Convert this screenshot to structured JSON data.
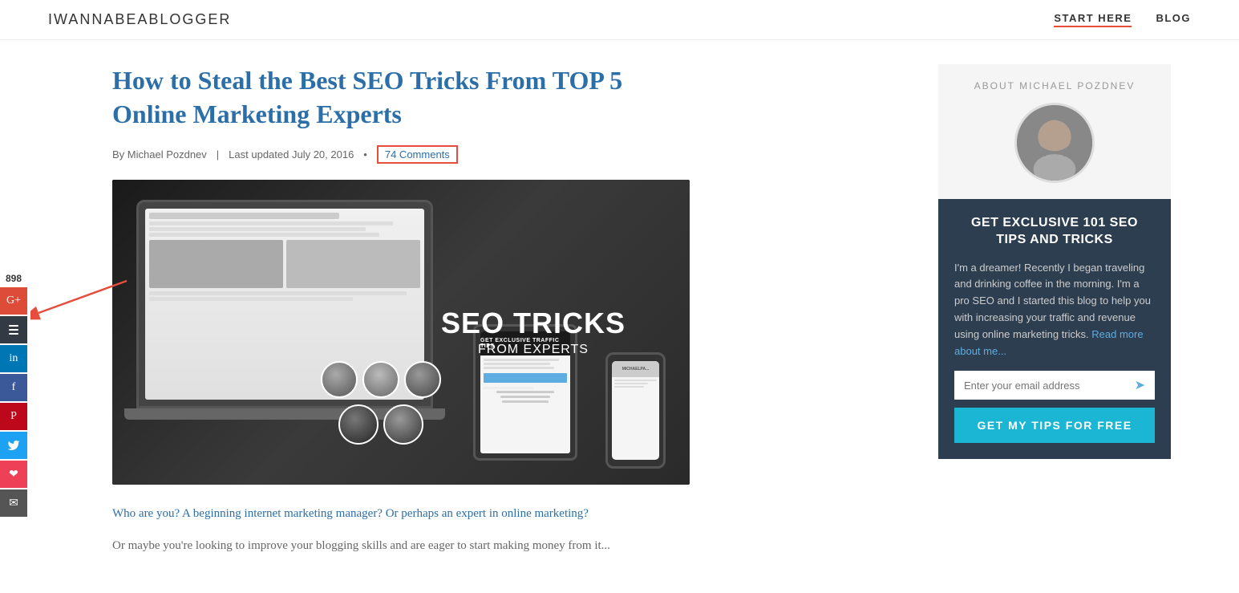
{
  "header": {
    "site_title": "IWANNABEABLOGGER",
    "nav": [
      {
        "label": "START HERE",
        "active": true
      },
      {
        "label": "BLOG",
        "active": false
      }
    ]
  },
  "article": {
    "title": "How to Steal the Best SEO Tricks From TOP 5 Online Marketing Experts",
    "meta": {
      "author": "By Michael Pozdnev",
      "date": "Last updated July 20, 2016",
      "comments": "74 Comments"
    },
    "image_alt": "SEO Tricks From Experts feature image",
    "image_overlay_title": "SEO TRICKS",
    "image_overlay_sub": "FROM EXPERTS",
    "intro": "Who are you? A beginning internet marketing manager? Or perhaps an expert in online marketing?",
    "body": "Or maybe you're looking to improve your blogging skills and are eager to start making money from it..."
  },
  "social": {
    "share_count": "898",
    "buttons": [
      {
        "name": "google-plus",
        "icon": "G+",
        "class": "google"
      },
      {
        "name": "buffer",
        "icon": "⊟",
        "class": "buffer"
      },
      {
        "name": "linkedin",
        "icon": "in",
        "class": "linkedin"
      },
      {
        "name": "facebook",
        "icon": "f",
        "class": "facebook"
      },
      {
        "name": "pinterest",
        "icon": "P",
        "class": "pinterest"
      },
      {
        "name": "twitter",
        "icon": "🐦",
        "class": "twitter"
      },
      {
        "name": "pocket",
        "icon": "❤",
        "class": "pocket"
      },
      {
        "name": "email",
        "icon": "✉",
        "class": "email"
      }
    ]
  },
  "sidebar": {
    "about_title": "ABOUT MICHAEL POZDNEV",
    "cta_title": "GET EXCLUSIVE 101 SEO TIPS AND TRICKS",
    "cta_description": "I'm a dreamer! Recently I began traveling and drinking coffee in the morning. I'm a pro SEO and I started this blog to help you with increasing your traffic and revenue using online marketing tricks.",
    "read_more_link": "Read more about me...",
    "email_placeholder": "Enter your email address",
    "cta_button_label": "GET MY TIPS FOR FREE"
  }
}
